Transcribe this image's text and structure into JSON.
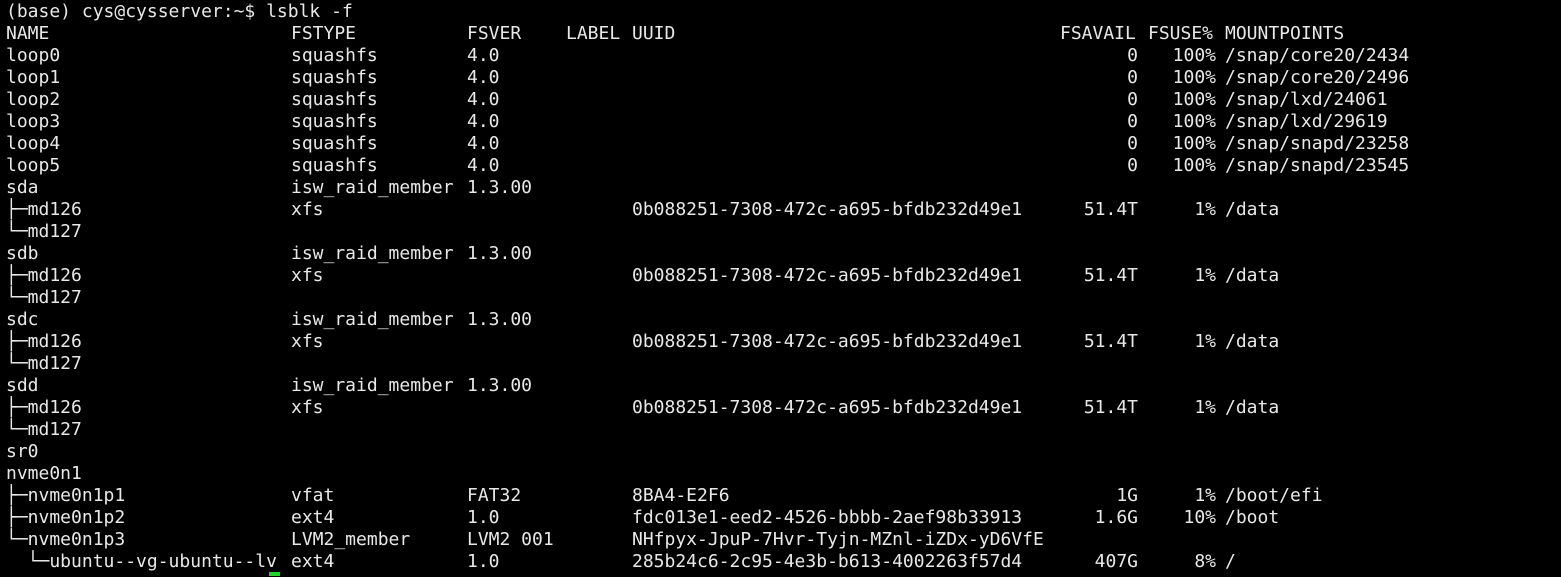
{
  "prompt": "(base) cys@cysserver:~$ lsblk -f",
  "headers": {
    "name": "NAME",
    "fstype": "FSTYPE",
    "fsver": "FSVER",
    "label": "LABEL",
    "uuid": "UUID",
    "fsavail": "FSAVAIL",
    "fsuse": "FSUSE%",
    "mountpoints": "MOUNTPOINTS"
  },
  "rows": [
    {
      "name": "loop0",
      "fstype": "squashfs",
      "fsver": "4.0",
      "label": "",
      "uuid": "",
      "fsavail": "0",
      "fsuse": "100%",
      "mount": "/snap/core20/2434"
    },
    {
      "name": "loop1",
      "fstype": "squashfs",
      "fsver": "4.0",
      "label": "",
      "uuid": "",
      "fsavail": "0",
      "fsuse": "100%",
      "mount": "/snap/core20/2496"
    },
    {
      "name": "loop2",
      "fstype": "squashfs",
      "fsver": "4.0",
      "label": "",
      "uuid": "",
      "fsavail": "0",
      "fsuse": "100%",
      "mount": "/snap/lxd/24061"
    },
    {
      "name": "loop3",
      "fstype": "squashfs",
      "fsver": "4.0",
      "label": "",
      "uuid": "",
      "fsavail": "0",
      "fsuse": "100%",
      "mount": "/snap/lxd/29619"
    },
    {
      "name": "loop4",
      "fstype": "squashfs",
      "fsver": "4.0",
      "label": "",
      "uuid": "",
      "fsavail": "0",
      "fsuse": "100%",
      "mount": "/snap/snapd/23258"
    },
    {
      "name": "loop5",
      "fstype": "squashfs",
      "fsver": "4.0",
      "label": "",
      "uuid": "",
      "fsavail": "0",
      "fsuse": "100%",
      "mount": "/snap/snapd/23545"
    },
    {
      "name": "sda",
      "fstype": "isw_raid_member",
      "fsver": "1.3.00",
      "label": "",
      "uuid": "",
      "fsavail": "",
      "fsuse": "",
      "mount": ""
    },
    {
      "name": "├─md126",
      "fstype": "xfs",
      "fsver": "",
      "label": "",
      "uuid": "0b088251-7308-472c-a695-bfdb232d49e1",
      "fsavail": "51.4T",
      "fsuse": "1%",
      "mount": "/data"
    },
    {
      "name": "└─md127",
      "fstype": "",
      "fsver": "",
      "label": "",
      "uuid": "",
      "fsavail": "",
      "fsuse": "",
      "mount": ""
    },
    {
      "name": "sdb",
      "fstype": "isw_raid_member",
      "fsver": "1.3.00",
      "label": "",
      "uuid": "",
      "fsavail": "",
      "fsuse": "",
      "mount": ""
    },
    {
      "name": "├─md126",
      "fstype": "xfs",
      "fsver": "",
      "label": "",
      "uuid": "0b088251-7308-472c-a695-bfdb232d49e1",
      "fsavail": "51.4T",
      "fsuse": "1%",
      "mount": "/data"
    },
    {
      "name": "└─md127",
      "fstype": "",
      "fsver": "",
      "label": "",
      "uuid": "",
      "fsavail": "",
      "fsuse": "",
      "mount": ""
    },
    {
      "name": "sdc",
      "fstype": "isw_raid_member",
      "fsver": "1.3.00",
      "label": "",
      "uuid": "",
      "fsavail": "",
      "fsuse": "",
      "mount": ""
    },
    {
      "name": "├─md126",
      "fstype": "xfs",
      "fsver": "",
      "label": "",
      "uuid": "0b088251-7308-472c-a695-bfdb232d49e1",
      "fsavail": "51.4T",
      "fsuse": "1%",
      "mount": "/data"
    },
    {
      "name": "└─md127",
      "fstype": "",
      "fsver": "",
      "label": "",
      "uuid": "",
      "fsavail": "",
      "fsuse": "",
      "mount": ""
    },
    {
      "name": "sdd",
      "fstype": "isw_raid_member",
      "fsver": "1.3.00",
      "label": "",
      "uuid": "",
      "fsavail": "",
      "fsuse": "",
      "mount": ""
    },
    {
      "name": "├─md126",
      "fstype": "xfs",
      "fsver": "",
      "label": "",
      "uuid": "0b088251-7308-472c-a695-bfdb232d49e1",
      "fsavail": "51.4T",
      "fsuse": "1%",
      "mount": "/data"
    },
    {
      "name": "└─md127",
      "fstype": "",
      "fsver": "",
      "label": "",
      "uuid": "",
      "fsavail": "",
      "fsuse": "",
      "mount": ""
    },
    {
      "name": "sr0",
      "fstype": "",
      "fsver": "",
      "label": "",
      "uuid": "",
      "fsavail": "",
      "fsuse": "",
      "mount": ""
    },
    {
      "name": "nvme0n1",
      "fstype": "",
      "fsver": "",
      "label": "",
      "uuid": "",
      "fsavail": "",
      "fsuse": "",
      "mount": ""
    },
    {
      "name": "├─nvme0n1p1",
      "fstype": "vfat",
      "fsver": "FAT32",
      "label": "",
      "uuid": "8BA4-E2F6",
      "fsavail": "1G",
      "fsuse": "1%",
      "mount": "/boot/efi"
    },
    {
      "name": "├─nvme0n1p2",
      "fstype": "ext4",
      "fsver": "1.0",
      "label": "",
      "uuid": "fdc013e1-eed2-4526-bbbb-2aef98b33913",
      "fsavail": "1.6G",
      "fsuse": "10%",
      "mount": "/boot"
    },
    {
      "name": "└─nvme0n1p3",
      "fstype": "LVM2_member",
      "fsver": "LVM2 001",
      "label": "",
      "uuid": "NHfpyx-JpuP-7Hvr-Tyjn-MZnl-iZDx-yD6VfE",
      "fsavail": "",
      "fsuse": "",
      "mount": ""
    },
    {
      "name": "  └─ubuntu--vg-ubuntu--lv",
      "fstype": "ext4",
      "fsver": "1.0",
      "label": "",
      "uuid": "285b24c6-2c95-4e3b-b613-4002263f57d4",
      "fsavail": "407G",
      "fsuse": "8%",
      "mount": "/"
    }
  ],
  "colors": {
    "background": "#000000",
    "foreground": "#e8e8e8",
    "cursor": "#21d12b"
  }
}
